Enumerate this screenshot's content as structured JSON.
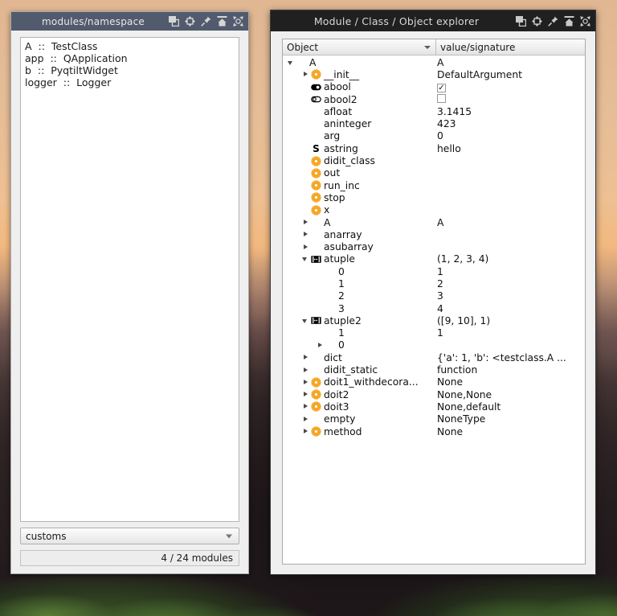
{
  "desktop": {
    "wallpaper_sky_color": "#eec093",
    "wallpaper_ground_color": "#1a1618"
  },
  "windows": {
    "modules": {
      "title": "modules/namespace",
      "titlebar_color": "#525b6d",
      "icons": [
        {
          "name": "restore-icon",
          "glyph": "restore"
        },
        {
          "name": "move-icon",
          "glyph": "move"
        },
        {
          "name": "pin-icon",
          "glyph": "pin"
        },
        {
          "name": "shade-icon",
          "glyph": "shade"
        },
        {
          "name": "close-icon",
          "glyph": "close"
        }
      ],
      "namespace_items": [
        "A  ::  TestClass",
        "app  ::  QApplication",
        "b  ::  PyqtiltWidget",
        "logger  ::  Logger"
      ],
      "filter_combo": {
        "value": "customs",
        "placeholder": "customs"
      },
      "status": "4 / 24 modules"
    },
    "explorer": {
      "title": "Module / Class / Object explorer",
      "titlebar_color": "#202020",
      "icons": [
        {
          "name": "restore-icon",
          "glyph": "restore"
        },
        {
          "name": "move-icon",
          "glyph": "move"
        },
        {
          "name": "pin-icon",
          "glyph": "pin"
        },
        {
          "name": "shade-icon",
          "glyph": "shade"
        },
        {
          "name": "close-icon",
          "glyph": "close"
        }
      ],
      "columns": [
        {
          "label": "Object",
          "sortable": true
        },
        {
          "label": "value/signature",
          "sortable": false
        }
      ],
      "rows": [
        {
          "indent": 0,
          "arrow": "open",
          "icon": "none",
          "label": "A",
          "value": "A"
        },
        {
          "indent": 1,
          "arrow": "closed",
          "icon": "gear",
          "label": "__init__",
          "value": "DefaultArgument"
        },
        {
          "indent": 1,
          "arrow": "none",
          "icon": "bool-on",
          "label": "abool",
          "value": "",
          "value_widget": "checkbox-checked"
        },
        {
          "indent": 1,
          "arrow": "none",
          "icon": "bool-off",
          "label": "abool2",
          "value": "",
          "value_widget": "checkbox-unchecked"
        },
        {
          "indent": 1,
          "arrow": "none",
          "icon": "none",
          "label": "afloat",
          "value": "3.1415"
        },
        {
          "indent": 1,
          "arrow": "none",
          "icon": "none",
          "label": "aninteger",
          "value": "423"
        },
        {
          "indent": 1,
          "arrow": "none",
          "icon": "none",
          "label": "arg",
          "value": "0"
        },
        {
          "indent": 1,
          "arrow": "none",
          "icon": "string",
          "label": "astring",
          "value": "hello"
        },
        {
          "indent": 1,
          "arrow": "none",
          "icon": "gear",
          "label": "didit_class",
          "value": ""
        },
        {
          "indent": 1,
          "arrow": "none",
          "icon": "gear",
          "label": "out",
          "value": ""
        },
        {
          "indent": 1,
          "arrow": "none",
          "icon": "gear",
          "label": "run_inc",
          "value": ""
        },
        {
          "indent": 1,
          "arrow": "none",
          "icon": "gear",
          "label": "stop",
          "value": ""
        },
        {
          "indent": 1,
          "arrow": "none",
          "icon": "gear",
          "label": "x",
          "value": ""
        },
        {
          "indent": 1,
          "arrow": "closed",
          "icon": "none",
          "label": "A",
          "value": "A"
        },
        {
          "indent": 1,
          "arrow": "closed",
          "icon": "none",
          "label": "anarray",
          "value": ""
        },
        {
          "indent": 1,
          "arrow": "closed",
          "icon": "none",
          "label": "asubarray",
          "value": ""
        },
        {
          "indent": 1,
          "arrow": "open",
          "icon": "tuple",
          "label": "atuple",
          "value": "(1, 2, 3, 4)"
        },
        {
          "indent": 2,
          "arrow": "none",
          "icon": "none",
          "label": "0",
          "value": "1"
        },
        {
          "indent": 2,
          "arrow": "none",
          "icon": "none",
          "label": "1",
          "value": "2"
        },
        {
          "indent": 2,
          "arrow": "none",
          "icon": "none",
          "label": "2",
          "value": "3"
        },
        {
          "indent": 2,
          "arrow": "none",
          "icon": "none",
          "label": "3",
          "value": "4"
        },
        {
          "indent": 1,
          "arrow": "open",
          "icon": "tuple",
          "label": "atuple2",
          "value": "([9, 10], 1)"
        },
        {
          "indent": 2,
          "arrow": "none",
          "icon": "none",
          "label": "1",
          "value": "1"
        },
        {
          "indent": 2,
          "arrow": "closed",
          "icon": "none",
          "label": "0",
          "value": ""
        },
        {
          "indent": 1,
          "arrow": "closed",
          "icon": "none",
          "label": "dict",
          "value": "{'a': 1, 'b': <testclass.A ..."
        },
        {
          "indent": 1,
          "arrow": "closed",
          "icon": "none",
          "label": "didit_static",
          "value": "function"
        },
        {
          "indent": 1,
          "arrow": "closed",
          "icon": "gear",
          "label": "doit1_withdecora...",
          "value": "None"
        },
        {
          "indent": 1,
          "arrow": "closed",
          "icon": "gear",
          "label": "doit2",
          "value": "None,None"
        },
        {
          "indent": 1,
          "arrow": "closed",
          "icon": "gear",
          "label": "doit3",
          "value": "None,default"
        },
        {
          "indent": 1,
          "arrow": "closed",
          "icon": "none",
          "label": "empty",
          "value": "NoneType"
        },
        {
          "indent": 1,
          "arrow": "closed",
          "icon": "gear",
          "label": "method",
          "value": "None"
        }
      ]
    }
  },
  "colors": {
    "gear_icon": "#f5a623",
    "titlebar_left": "#525b6d",
    "titlebar_right": "#202020",
    "panel_bg": "#efefef"
  }
}
